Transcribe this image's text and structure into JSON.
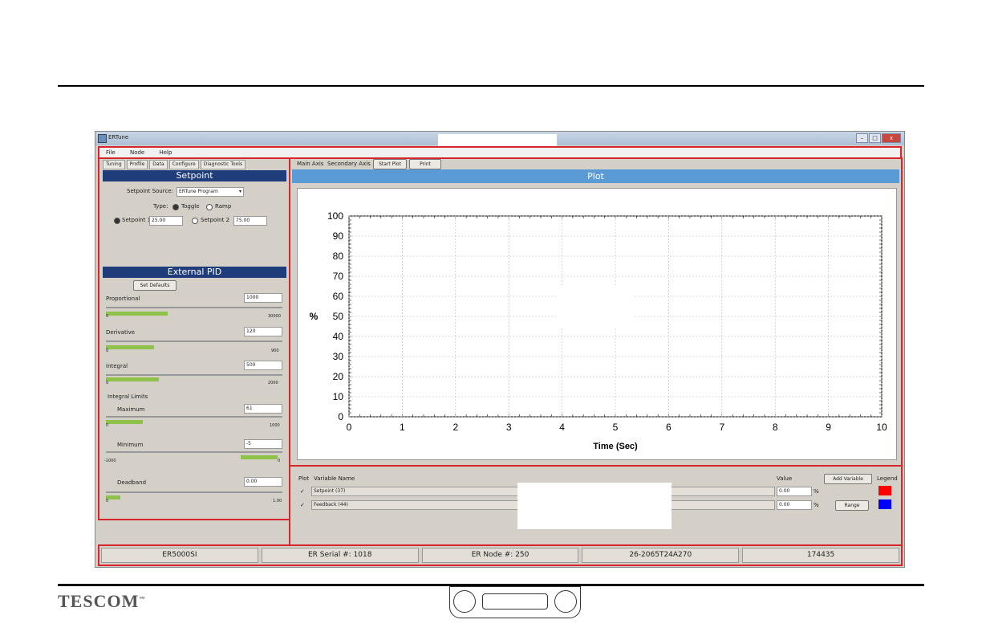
{
  "page": {
    "logo": "TESCOM",
    "logo_tm": "™"
  },
  "app": {
    "title": "ERTune",
    "menu": [
      "File",
      "Node",
      "Help"
    ],
    "window_buttons": [
      "–",
      "□",
      "x"
    ]
  },
  "left": {
    "tabs": [
      "Tuning",
      "Profile",
      "Data",
      "Configure",
      "Diagnostic Tools"
    ],
    "setpoint": {
      "header": "Setpoint",
      "source_label": "Setpoint Source:",
      "source_value": "ERTune Program",
      "type_label": "Type:",
      "type_options": [
        "Toggle",
        "Ramp"
      ],
      "type_selected": "Toggle",
      "sp1_label": "Setpoint 1",
      "sp1_value": "25.00",
      "sp2_label": "Setpoint 2",
      "sp2_value": "75.00"
    },
    "pid": {
      "header": "External PID",
      "set_defaults": "Set Defaults",
      "proportional": {
        "label": "Proportional",
        "value": "1000",
        "min": "0",
        "max": "30000",
        "level": 0.35
      },
      "derivative": {
        "label": "Derivative",
        "value": "120",
        "min": "0",
        "max": "900",
        "level": 0.2
      },
      "integral": {
        "label": "Integral",
        "value": "500",
        "min": "0",
        "max": "2000",
        "level": 0.3
      },
      "integral_limits_label": "Integral Limits",
      "maximum": {
        "label": "Maximum",
        "value": "61",
        "min": "0",
        "max": "1000",
        "level": 0.2
      },
      "minimum": {
        "label": "Minimum",
        "value": "-5",
        "min": "-1000",
        "max": "0",
        "level": 0.2
      },
      "deadband": {
        "label": "Deadband",
        "value": "0.00",
        "min": "0",
        "max": "1.00",
        "level": 0.08
      }
    }
  },
  "plot": {
    "axis_tabs": [
      "Main Axis",
      "Secondary Axis"
    ],
    "start_plot": "Start Plot",
    "print": "Print",
    "header": "Plot"
  },
  "chart_data": {
    "type": "line",
    "xlabel": "Time (Sec)",
    "ylabel": "%",
    "xlim": [
      0,
      10
    ],
    "ylim": [
      0,
      100
    ],
    "x_ticks": [
      "0",
      "1",
      "2",
      "3",
      "4",
      "5",
      "6",
      "7",
      "8",
      "9",
      "10"
    ],
    "y_ticks": [
      "0",
      "10",
      "20",
      "30",
      "40",
      "50",
      "60",
      "70",
      "80",
      "90",
      "100"
    ],
    "grid": true,
    "series": []
  },
  "variables": {
    "col_plot": "Plot",
    "col_name": "Variable Name",
    "col_value": "Value",
    "add_variable": "Add Variable",
    "legend_label": "Legend",
    "range": "Range",
    "rows": [
      {
        "name": "Setpoint (37)",
        "value": "0.00",
        "unit": "%",
        "color": "#ff0000"
      },
      {
        "name": "Feedback (44)",
        "value": "0.00",
        "unit": "%",
        "color": "#0000ff"
      }
    ]
  },
  "status": [
    "ER5000SI",
    "ER Serial #: 1018",
    "ER Node #: 250",
    "26-2065T24A270",
    "174435"
  ]
}
